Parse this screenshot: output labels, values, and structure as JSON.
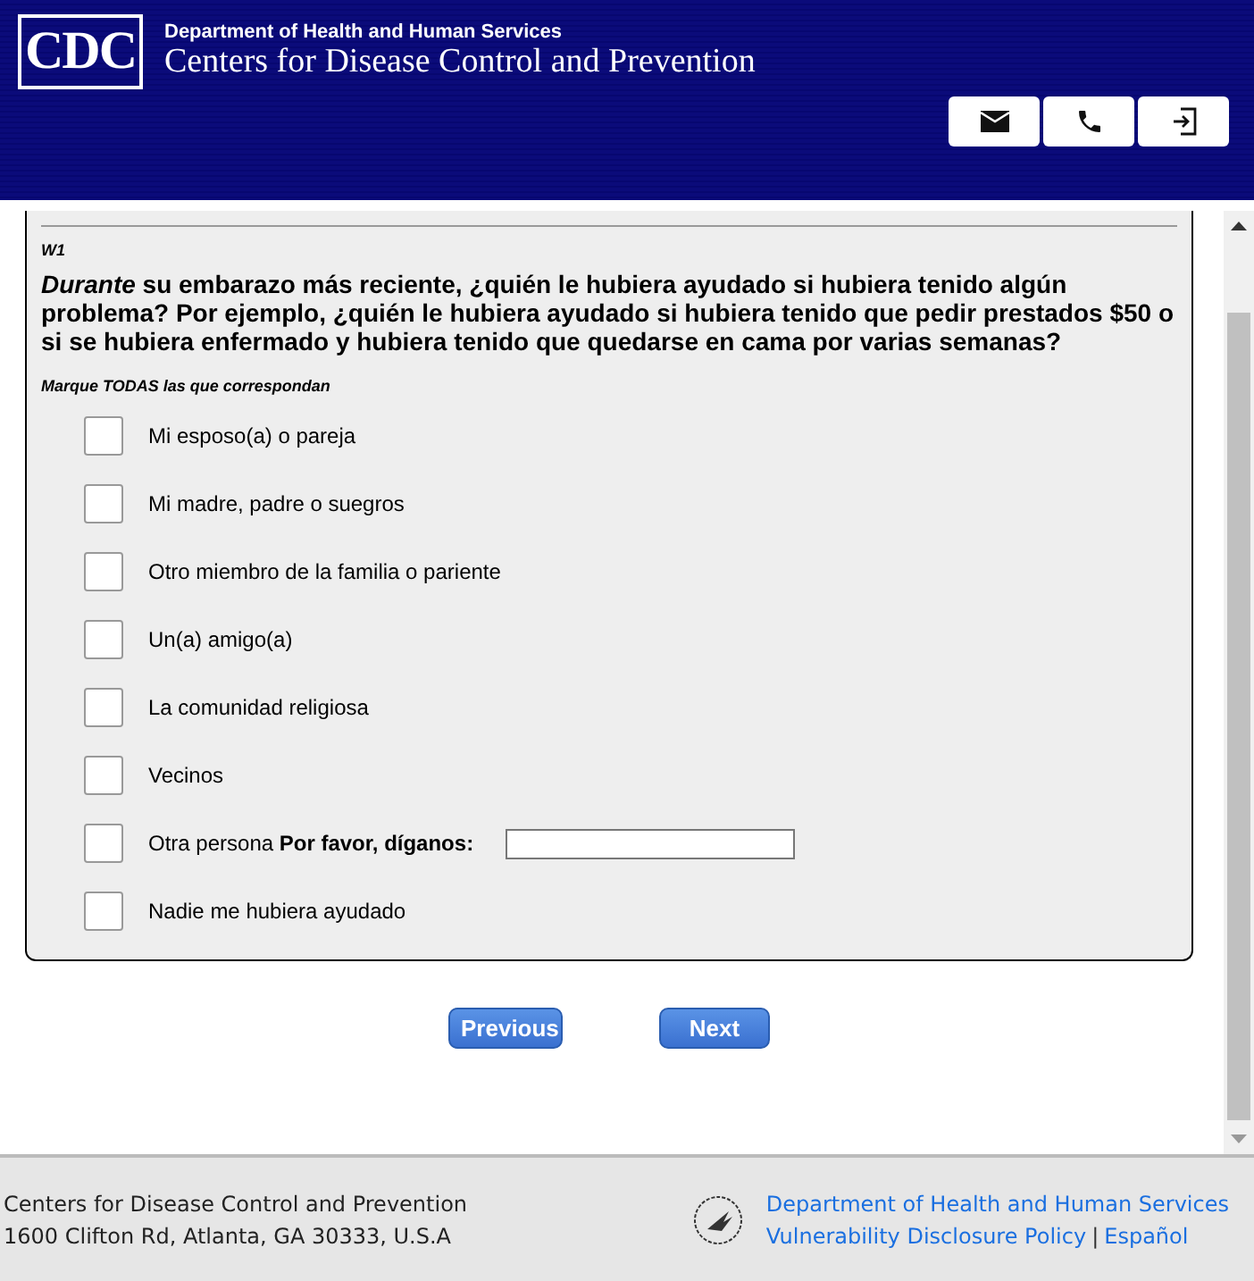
{
  "header": {
    "logo": "CDC",
    "department": "Department of Health and Human Services",
    "agency": "Centers for Disease Control and Prevention",
    "actions": [
      {
        "kind": "email"
      },
      {
        "kind": "phone"
      },
      {
        "kind": "exit"
      }
    ]
  },
  "question": {
    "code": "W1",
    "text": "*Durante* su embarazo más reciente, ¿quién le hubiera ayudado si hubiera tenido algún problema? Por ejemplo, ¿quién le hubiera ayudado si hubiera tenido que pedir prestados $50 o si se hubiera enfermado y hubiera tenido que quedarse en cama por varias semanas?",
    "instruction": "Marque TODAS las que correspondan",
    "options": [
      {
        "label": "Mi esposo(a) o pareja",
        "checked": false
      },
      {
        "label": "Mi madre, padre o suegros",
        "checked": false
      },
      {
        "label": "Otro miembro de la familia o pariente",
        "checked": false
      },
      {
        "label": "Un(a) amigo(a)",
        "checked": false
      },
      {
        "label": "La comunidad religiosa",
        "checked": false
      },
      {
        "label": "Vecinos",
        "checked": false
      },
      {
        "label": "Otra persona **Por favor, díganos:**",
        "checked": false,
        "kind": "other"
      },
      {
        "label": "Nadie me hubiera ayudado",
        "checked": false
      }
    ]
  },
  "navigation": [
    "Previous",
    "Next"
  ],
  "footer": {
    "name": "Centers for Disease Control and Prevention",
    "address": "1600 Clifton Rd, Atlanta, GA 30333, U.S.A",
    "links": [
      "Department of Health and Human Services",
      "Vulnerability Disclosure Policy",
      "Español"
    ],
    "separator": "|"
  }
}
